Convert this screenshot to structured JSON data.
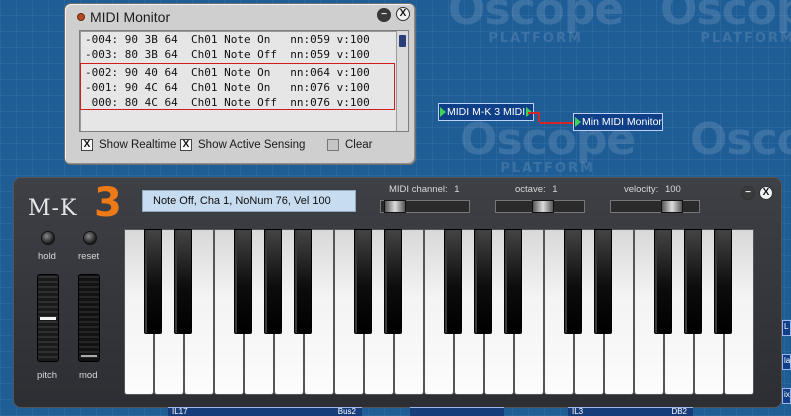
{
  "watermark": {
    "main": "Oscope",
    "sub": "PLATFORM"
  },
  "midi_monitor": {
    "title": "MIDI Monitor",
    "rows": [
      "-004: 90 3B 64  Ch01 Note On   nn:059 v:100",
      "-003: 80 3B 64  Ch01 Note Off  nn:059 v:100",
      "-002: 90 40 64  Ch01 Note On   nn:064 v:100",
      "-001: 90 4C 64  Ch01 Note On   nn:076 v:100",
      " 000: 80 4C 64  Ch01 Note Off  nn:076 v:100"
    ],
    "show_realtime": {
      "label": "Show Realtime",
      "checked": true,
      "mark": "X"
    },
    "show_active_sensing": {
      "label": "Show Active Sensing",
      "checked": true,
      "mark": "X"
    },
    "clear": {
      "label": "Clear",
      "checked": false
    }
  },
  "window_buttons": {
    "minimize": "−",
    "close": "X"
  },
  "modules": {
    "mk3_midi": "MIDI M-K 3 MIDI",
    "midi_monitor_in": "Min MIDI Monitor"
  },
  "mk3": {
    "logo_text": "M-K",
    "logo_number": "3",
    "display": "Note Off, Cha 1, NoNum 76, Vel 100",
    "midi_channel": {
      "label": "MIDI channel:",
      "value": "1"
    },
    "octave": {
      "label": "octave:",
      "value": "1"
    },
    "velocity": {
      "label": "velocity:",
      "value": "100"
    },
    "hold_label": "hold",
    "reset_label": "reset",
    "pitch_label": "pitch",
    "mod_label": "mod"
  },
  "bottom_strips": {
    "s1": "IL17",
    "s2": "Bus2",
    "s3": "IL3",
    "s4": "DB2"
  },
  "right_edge": {
    "e1": "L",
    "e2": "lai",
    "e3": "ix"
  },
  "colors": {
    "accent_orange": "#ee7a17",
    "selection_red": "#d21b1b",
    "module_blue": "#0e3f87",
    "port_green": "#3fd25a",
    "background_blue": "#1f5d96"
  }
}
